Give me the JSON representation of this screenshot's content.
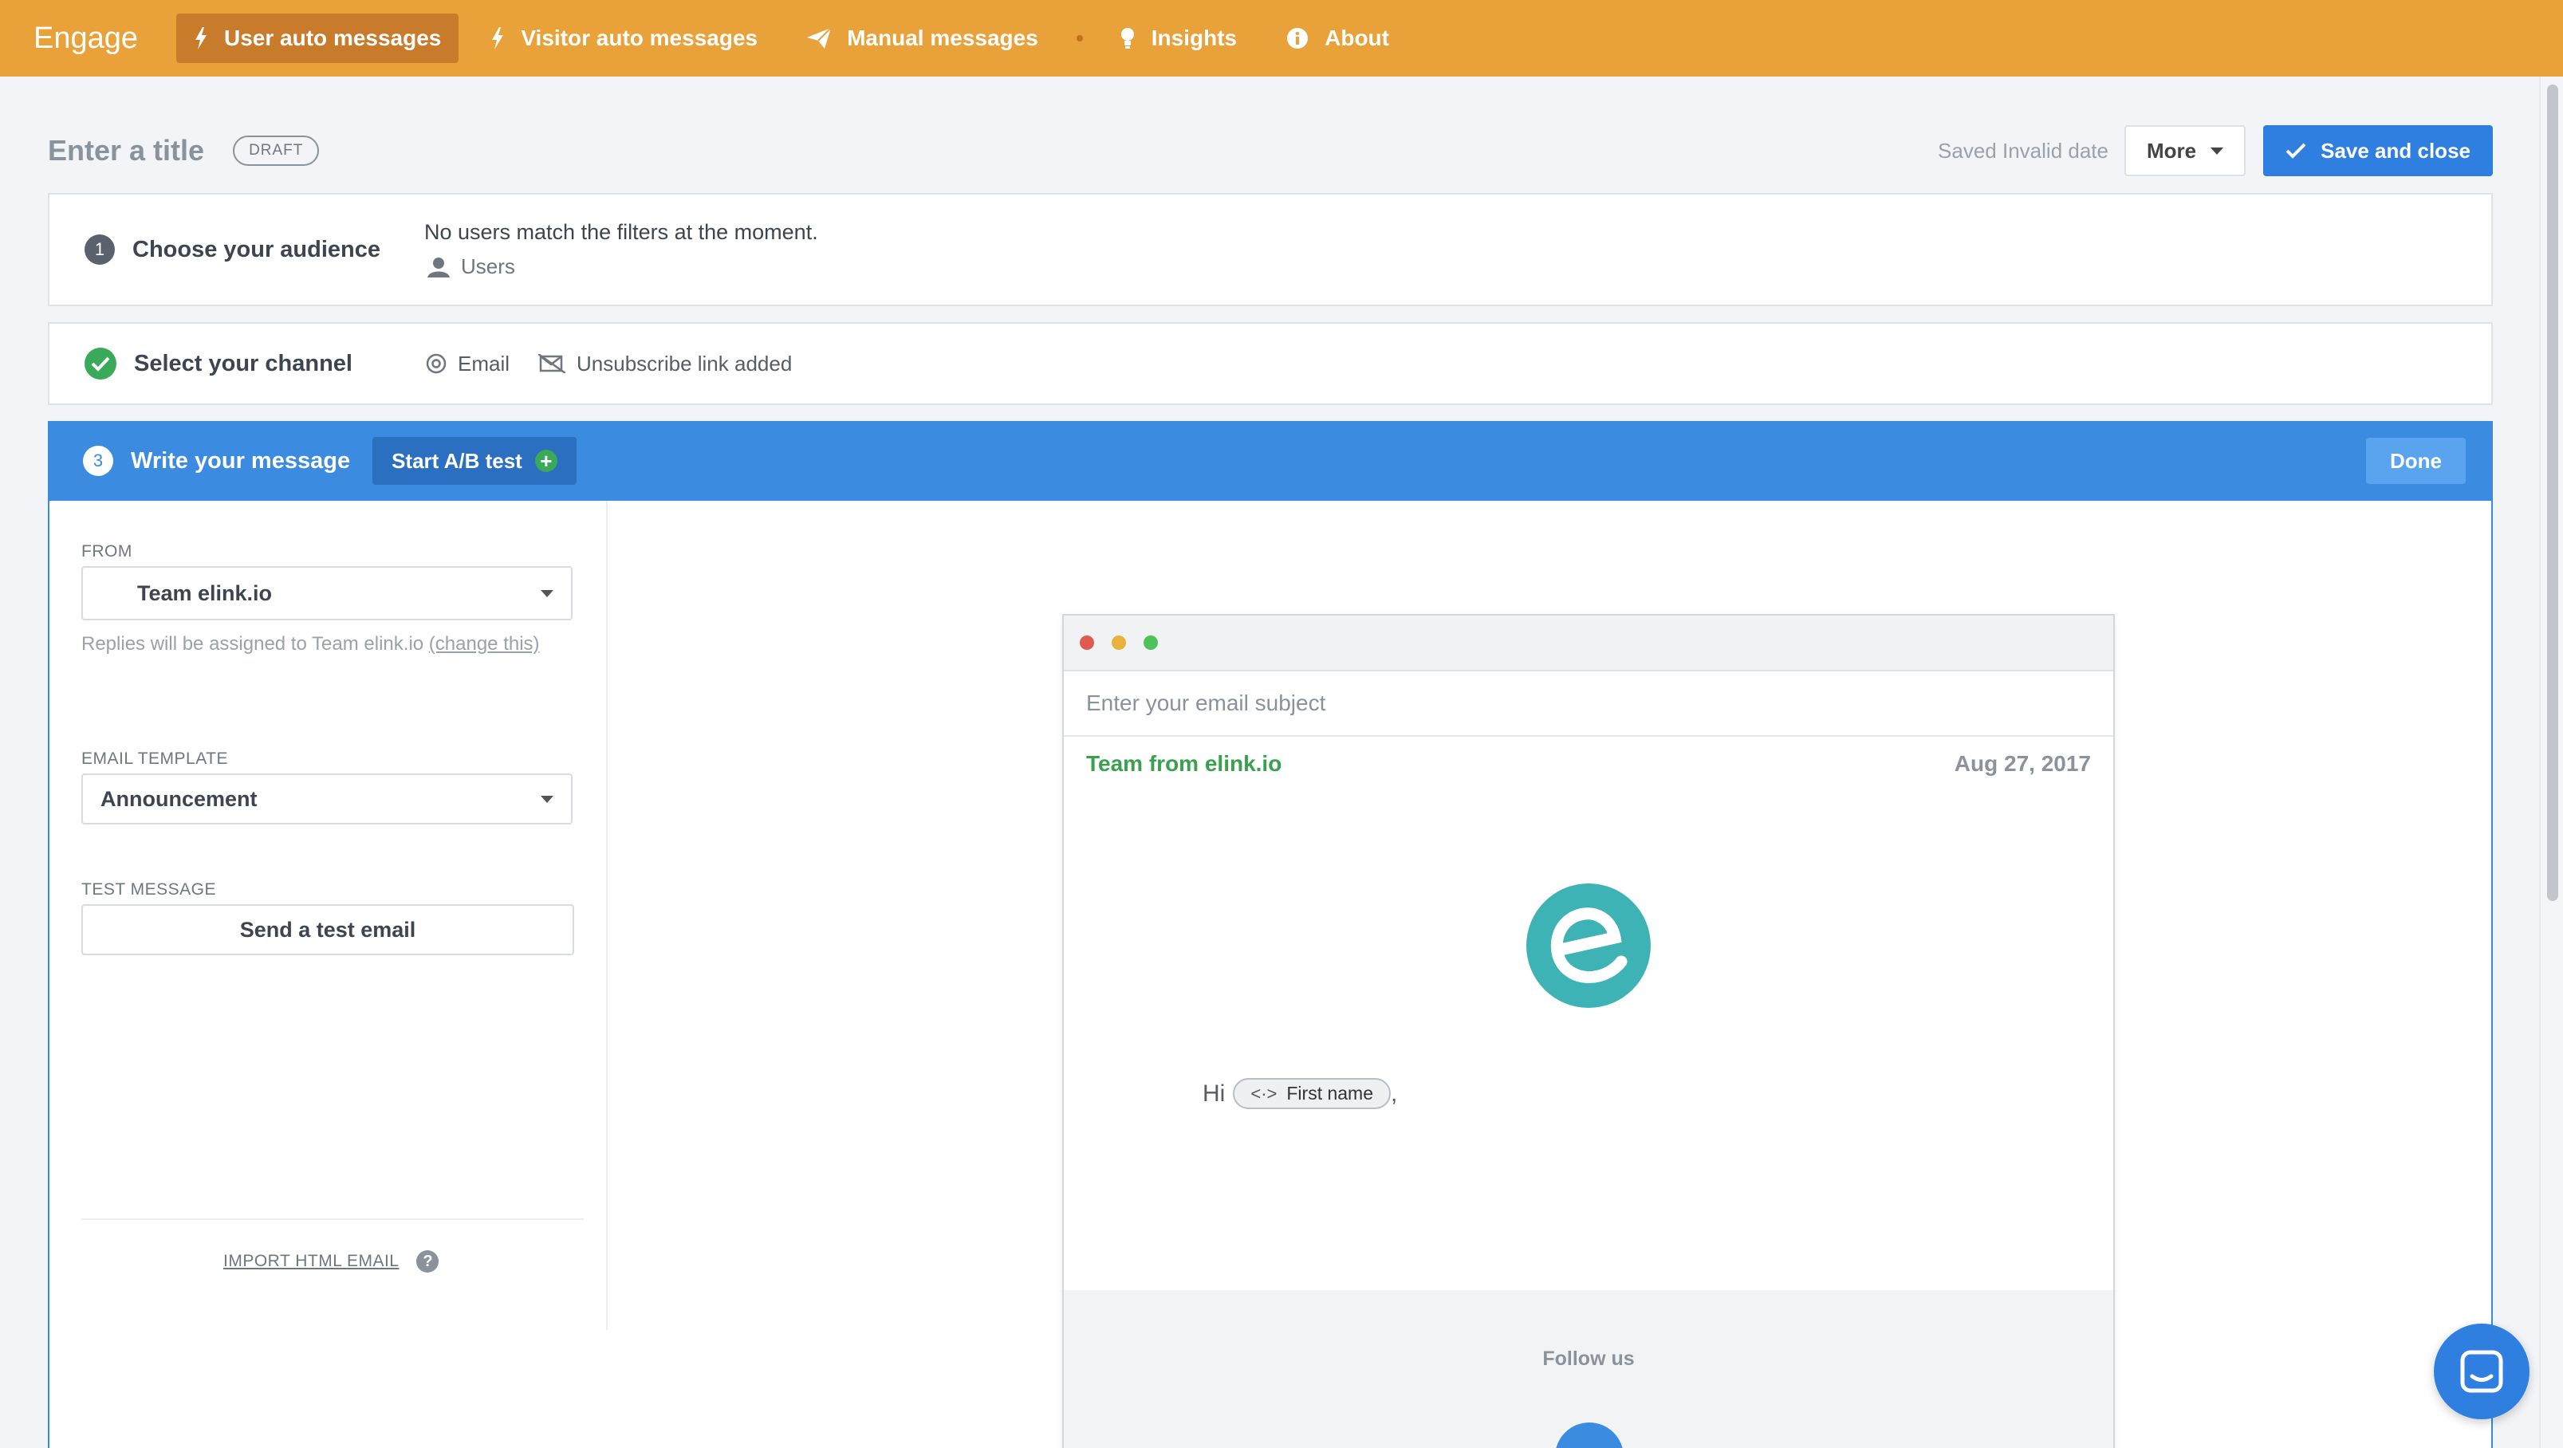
{
  "app": {
    "brand": "Engage"
  },
  "nav": {
    "items": [
      {
        "label": "User auto messages",
        "icon": "bolt-icon",
        "active": true
      },
      {
        "label": "Visitor auto messages",
        "icon": "bolt-icon",
        "active": false
      },
      {
        "label": "Manual messages",
        "icon": "paper-plane-icon",
        "active": false
      },
      {
        "label": "Insights",
        "icon": "lightbulb-icon",
        "active": false
      },
      {
        "label": "About",
        "icon": "info-icon",
        "active": false
      }
    ]
  },
  "header": {
    "title": "Enter a title",
    "badge": "DRAFT",
    "saved_text": "Saved Invalid date",
    "more_label": "More",
    "save_label": "Save and close"
  },
  "steps": {
    "audience": {
      "number": "1",
      "title": "Choose your audience",
      "message": "No users match the filters at the moment.",
      "users_label": "Users"
    },
    "channel": {
      "title": "Select your channel",
      "email_label": "Email",
      "unsubscribe_label": "Unsubscribe link added"
    },
    "write": {
      "number": "3",
      "title": "Write your message",
      "ab_label": "Start A/B test",
      "done_label": "Done"
    }
  },
  "form": {
    "from_label": "FROM",
    "from_value": "Team elink.io",
    "helper_text": "Replies will be assigned to Team elink.io ",
    "helper_link": "(change this)",
    "template_label": "EMAIL TEMPLATE",
    "template_value": "Announcement",
    "test_label": "TEST MESSAGE",
    "test_button": "Send a test email",
    "import_label": "IMPORT HTML EMAIL",
    "help_glyph": "?"
  },
  "preview": {
    "subject_placeholder": "Enter your email subject",
    "from": "Team from elink.io",
    "date": "Aug 27, 2017",
    "greeting": "Hi",
    "pill_code": "<·>",
    "pill_label": "First name",
    "greeting_suffix": ",",
    "follow_us": "Follow us"
  },
  "colors": {
    "topbar": "#e9a13a",
    "accent_blue": "#3b8be0",
    "success_green": "#3aaa5a",
    "logo_teal": "#3eb3b6"
  }
}
